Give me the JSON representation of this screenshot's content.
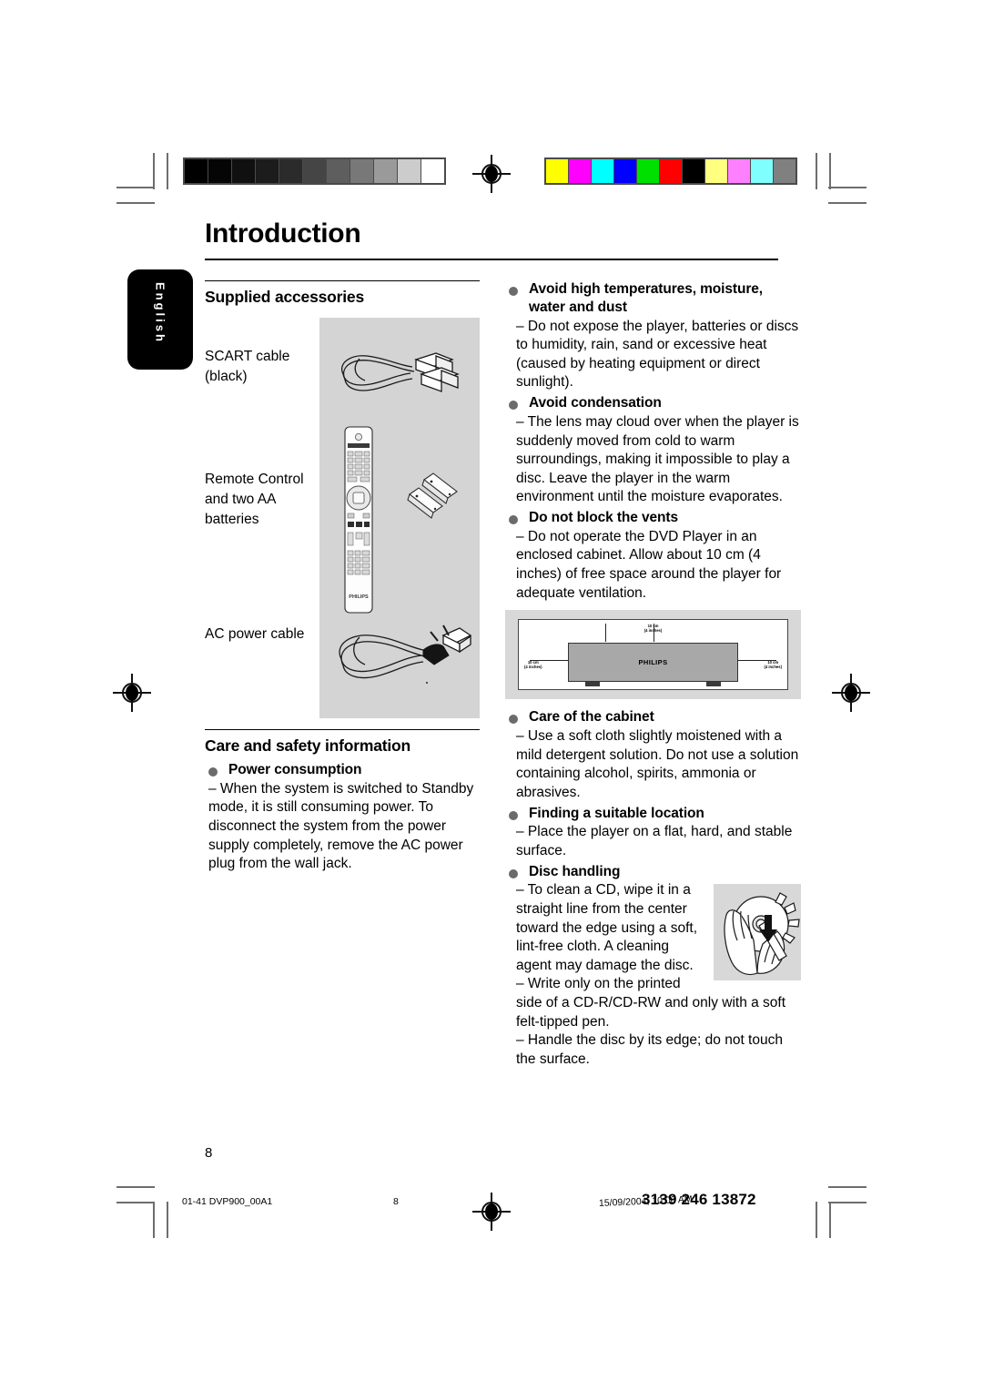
{
  "document": {
    "chapter_title": "Introduction",
    "language_tab": "English",
    "page_number": "8"
  },
  "colorbars": {
    "grayscale_label": "grayscale-calibration-bar",
    "grayscale": [
      "#000000",
      "#050505",
      "#101010",
      "#1c1c1c",
      "#2b2b2b",
      "#454545",
      "#5e5e5e",
      "#787878",
      "#9a9a9a",
      "#cccccc",
      "#ffffff"
    ],
    "color_label": "color-calibration-bar",
    "colors": [
      "#ffff00",
      "#ff00ff",
      "#00ffff",
      "#0000ff",
      "#00e000",
      "#ff0000",
      "#000000",
      "#ffff80",
      "#ff80ff",
      "#80ffff",
      "#808080"
    ]
  },
  "left_column": {
    "accessories": {
      "title": "Supplied accessories",
      "items": [
        {
          "label": "SCART cable\n(black)",
          "art": "scart-cable-illustration"
        },
        {
          "label": "Remote Control\nand two AA\nbatteries",
          "art": "remote-control-illustration"
        },
        {
          "label": "AC power cable",
          "art": "ac-power-cable-illustration"
        }
      ]
    },
    "care": {
      "title": "Care and safety information",
      "bullets": [
        {
          "heading": "Power consumption",
          "body": "–  When the system is switched to Standby mode, it is still consuming power. To disconnect the system from the power supply completely, remove the AC power plug from the wall jack."
        }
      ]
    }
  },
  "right_column": {
    "bullets": [
      {
        "heading": "Avoid high temperatures, moisture, water and dust",
        "body": "–  Do not expose the player, batteries or discs to humidity, rain, sand or excessive heat (caused by heating equipment or direct sunlight)."
      },
      {
        "heading": "Avoid condensation",
        "body": "–  The lens may cloud over when the player is suddenly moved from cold to warm surroundings, making it impossible to play a disc. Leave the player in the warm environment until the moisture evaporates."
      },
      {
        "heading": "Do not block the vents",
        "body": "–  Do not operate the DVD Player in an enclosed cabinet. Allow about 10 cm (4 inches) of free space around the player for adequate ventilation."
      },
      {
        "heading": "Care of the cabinet",
        "body": "–  Use a soft cloth slightly moistened with a mild detergent solution. Do not use a solution containing alcohol, spirits, ammonia or abrasives."
      },
      {
        "heading": "Finding a suitable location",
        "body": "–  Place the player on a flat, hard, and stable surface."
      },
      {
        "heading": "Disc handling",
        "body": "–  To clean a CD, wipe it in a straight line from the center toward the edge using a soft, lint-free cloth. A cleaning agent may damage the disc.\n–  Write only on the printed side of a CD-R/CD-RW and only with a soft felt-tipped pen.\n–  Handle the disc by its edge; do not touch the surface."
      }
    ],
    "ventilation_figure": {
      "device_label": "PHILIPS",
      "caption_top": "10 cm\n(4 inches)",
      "caption_left": "10 cm\n(4 inches)",
      "caption_right": "10 cm\n(4 inches)"
    },
    "disc_figure": "disc-cleaning-hand-illustration"
  },
  "footer": {
    "job_ref": "01-41 DVP900_00A1",
    "page": "8",
    "timestamp": "15/09/2004, 10:08 AM",
    "doc_code": "3139 246 13872"
  }
}
